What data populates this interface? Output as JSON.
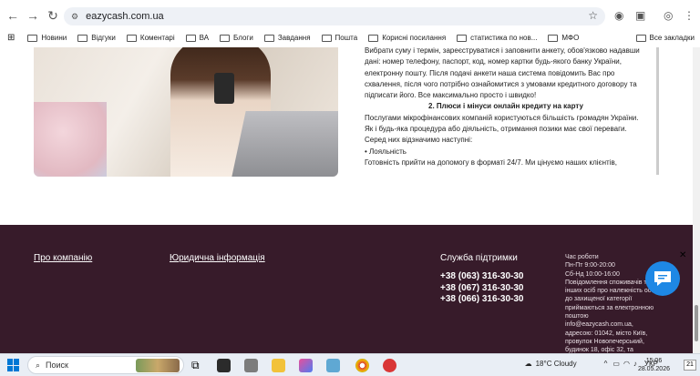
{
  "browser": {
    "url": "eazycash.com.ua",
    "bookmarks": [
      "Новини",
      "Відгуки",
      "Коментарі",
      "ВА",
      "Блоги",
      "Завдання",
      "Пошта",
      "Корисні посилання",
      "статистика по нов...",
      "МФО"
    ],
    "all_bookmarks": "Все закладки"
  },
  "article": {
    "p1": "Вибрати суму і термін, зареєструватися і заповнити анкету, обов'язково надавши дані: номер телефону, паспорт, код, номер картки будь-якого банку України, електронну пошту. Після подачі анкети наша система повідомить Вас про схвалення, після чого потрібно ознайомитися з умовами кредитного договору та підписати його. Все максимально просто і швидко!",
    "h2": "2. Плюси і мінуси онлайн кредиту на карту",
    "p2": "Послугами мікрофінансових компаній користуються більшість громадян України. Як і будь-яка процедура або діяльність, отримання позики має свої переваги. Серед них відзначимо наступні:",
    "bullet": "• Лояльність",
    "p3": "Готовність прийти на допомогу в форматі 24/7. Ми цінуємо наших клієнтів,"
  },
  "footer": {
    "about": "Про компанію",
    "legal": "Юридична інформація",
    "support_title": "Служба підтримки",
    "phones": [
      "+38 (063) 316-30-30",
      "+38 (067) 316-30-30",
      "+38 (066) 316-30-30"
    ],
    "hours_lines": [
      "Час роботи",
      "Пн-Пт 9:00-20:00",
      "Сб-Нд 10:00-16:00",
      "Повідомлення споживачів та інших осіб про належність особи до захищеної категорії приймаються за електронною поштою",
      "info@eazycash.com.ua,",
      "адресою: 01042, місто Київ, провулок Новопечерський, будинок 18, офіс 32, та"
    ]
  },
  "taskbar": {
    "search_label": "Поиск",
    "weather": "18°C  Cloudy",
    "lang": "УКР",
    "time": "15:06",
    "date": "28.05.2026",
    "notif_count": "21"
  }
}
